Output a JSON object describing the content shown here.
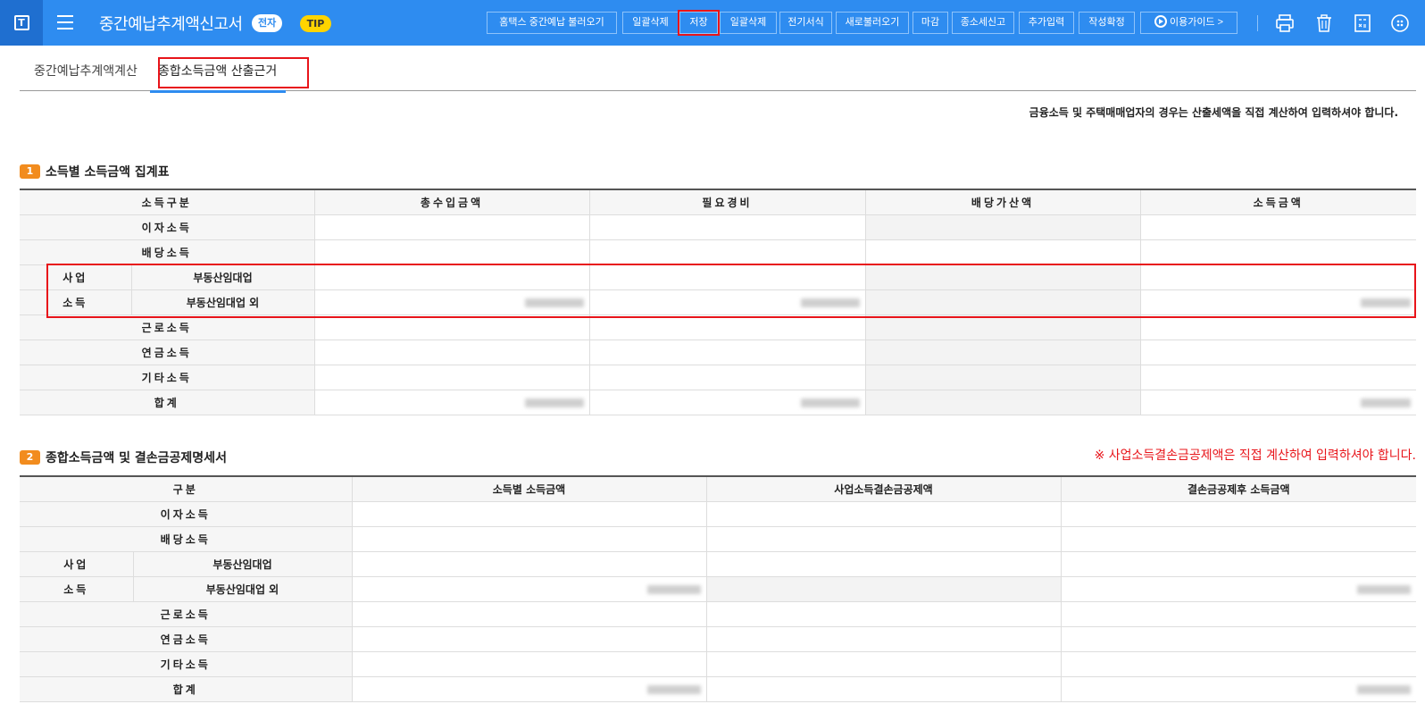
{
  "header": {
    "title": "중간예납추계액신고서",
    "badge_e": "전자",
    "badge_tip": "TIP",
    "buttons": [
      "홈택스 중간예납 불러오기",
      "일괄삭제",
      "저장",
      "일괄삭제",
      "전기서식",
      "새로불러오기",
      "마감",
      "종소세신고",
      "추가입력",
      "작성확정",
      "이용가이드 >"
    ],
    "icons": [
      "print-icon",
      "trash-icon",
      "calculator-icon",
      "settings-icon"
    ]
  },
  "tabs": {
    "tab1": "중간예납추계액계산",
    "tab2": "종합소득금액 산출근거"
  },
  "notice": "금융소득 및 주택매매업자의 경우는 산출세액을 직접 계산하여 입력하셔야 합니다.",
  "section1": {
    "num": "1",
    "title": "소득별 소득금액 집계표",
    "headers": [
      "소득구분",
      "총수입금액",
      "필요경비",
      "배당가산액",
      "소득금액"
    ],
    "rows": {
      "interest": "이자소득",
      "dividend": "배당소득",
      "business_top": "사업",
      "business_bottom": "소득",
      "realestate": "부동산임대업",
      "realestate_other": "부동산임대업 외",
      "labor": "근로소득",
      "pension": "연금소득",
      "other": "기타소득",
      "total": "합계"
    }
  },
  "section2": {
    "num": "2",
    "title": "종합소득금액 및 결손금공제명세서",
    "note": "※ 사업소득결손금공제액은 직접 계산하여 입력하셔야 합니다.",
    "headers": [
      "구분",
      "소득별 소득금액",
      "사업소득결손금공제액",
      "결손금공제후 소득금액"
    ],
    "rows": {
      "interest": "이자소득",
      "dividend": "배당소득",
      "business_top": "사업",
      "business_bottom": "소득",
      "realestate": "부동산임대업",
      "realestate_other": "부동산임대업 외",
      "labor": "근로소득",
      "pension": "연금소득",
      "other": "기타소득",
      "total": "합계"
    }
  },
  "colors": {
    "topbar": "#2e8cf0",
    "highlight": "#e8141a",
    "section_badge": "#f28c1e"
  }
}
